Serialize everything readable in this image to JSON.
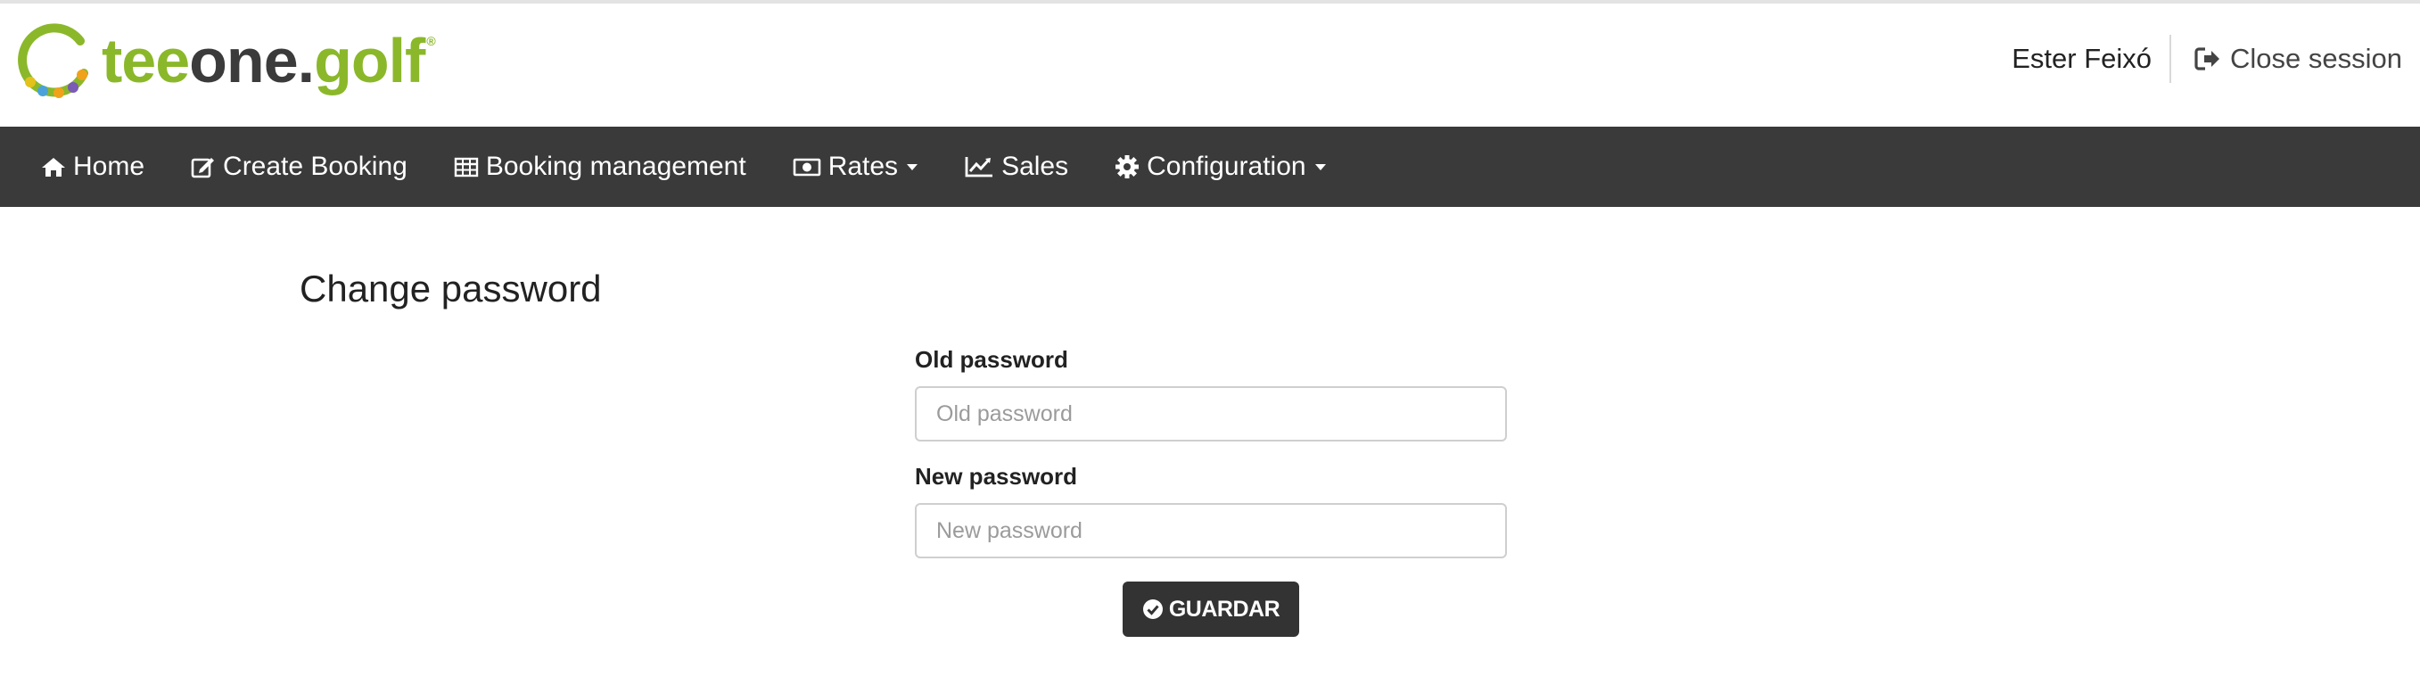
{
  "brand": {
    "logo_text_a": "tee",
    "logo_text_b": "one.",
    "logo_text_c": "golf",
    "registered_mark": "®",
    "colors": {
      "green": "#8bb82a",
      "dark": "#3b3b3b"
    }
  },
  "header": {
    "user_name": "Ester Feixó",
    "close_session_label": "Close session",
    "close_session_icon": "sign-out-icon"
  },
  "nav": {
    "background": "#3a3a3a",
    "items": [
      {
        "label": "Home",
        "icon": "home-icon",
        "dropdown": false
      },
      {
        "label": "Create Booking",
        "icon": "edit-icon",
        "dropdown": false
      },
      {
        "label": "Booking management",
        "icon": "table-icon",
        "dropdown": false
      },
      {
        "label": "Rates",
        "icon": "money-icon",
        "dropdown": true
      },
      {
        "label": "Sales",
        "icon": "line-chart-icon",
        "dropdown": false
      },
      {
        "label": "Configuration",
        "icon": "gear-icon",
        "dropdown": true
      }
    ]
  },
  "page": {
    "title": "Change password"
  },
  "form": {
    "old_password": {
      "label": "Old password",
      "placeholder": "Old password",
      "value": ""
    },
    "new_password": {
      "label": "New password",
      "placeholder": "New password",
      "value": ""
    },
    "save_button": {
      "label": "GUARDAR",
      "icon": "check-circle-icon"
    }
  }
}
